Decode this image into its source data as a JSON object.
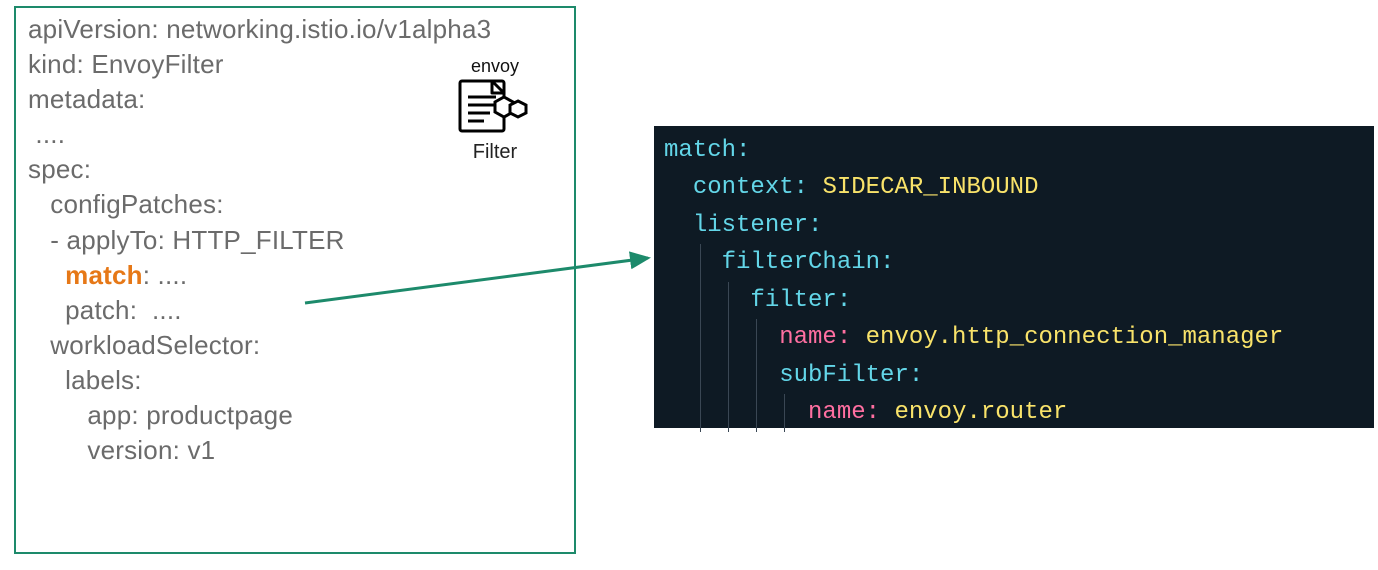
{
  "yaml": {
    "lines": [
      "apiVersion: networking.istio.io/v1alpha3",
      "kind: EnvoyFilter",
      "metadata:",
      " ....",
      "spec:",
      "   configPatches:",
      "   - applyTo: HTTP_FILTER",
      "",
      "     patch:  ....",
      "   workloadSelector:",
      "     labels:",
      "        app: productpage",
      "        version: v1"
    ],
    "match_key": "match",
    "match_rest": ": ...."
  },
  "badge": {
    "title": "envoy",
    "caption": "Filter"
  },
  "code": {
    "match_key": "match",
    "context_key": "context",
    "context_val": "SIDECAR_INBOUND",
    "listener_key": "listener",
    "filterChain_key": "filterChain",
    "filter_key": "filter",
    "name_key": "name",
    "name1_val": "envoy.http_connection_manager",
    "subFilter_key": "subFilter",
    "name2_val": "envoy.router"
  }
}
